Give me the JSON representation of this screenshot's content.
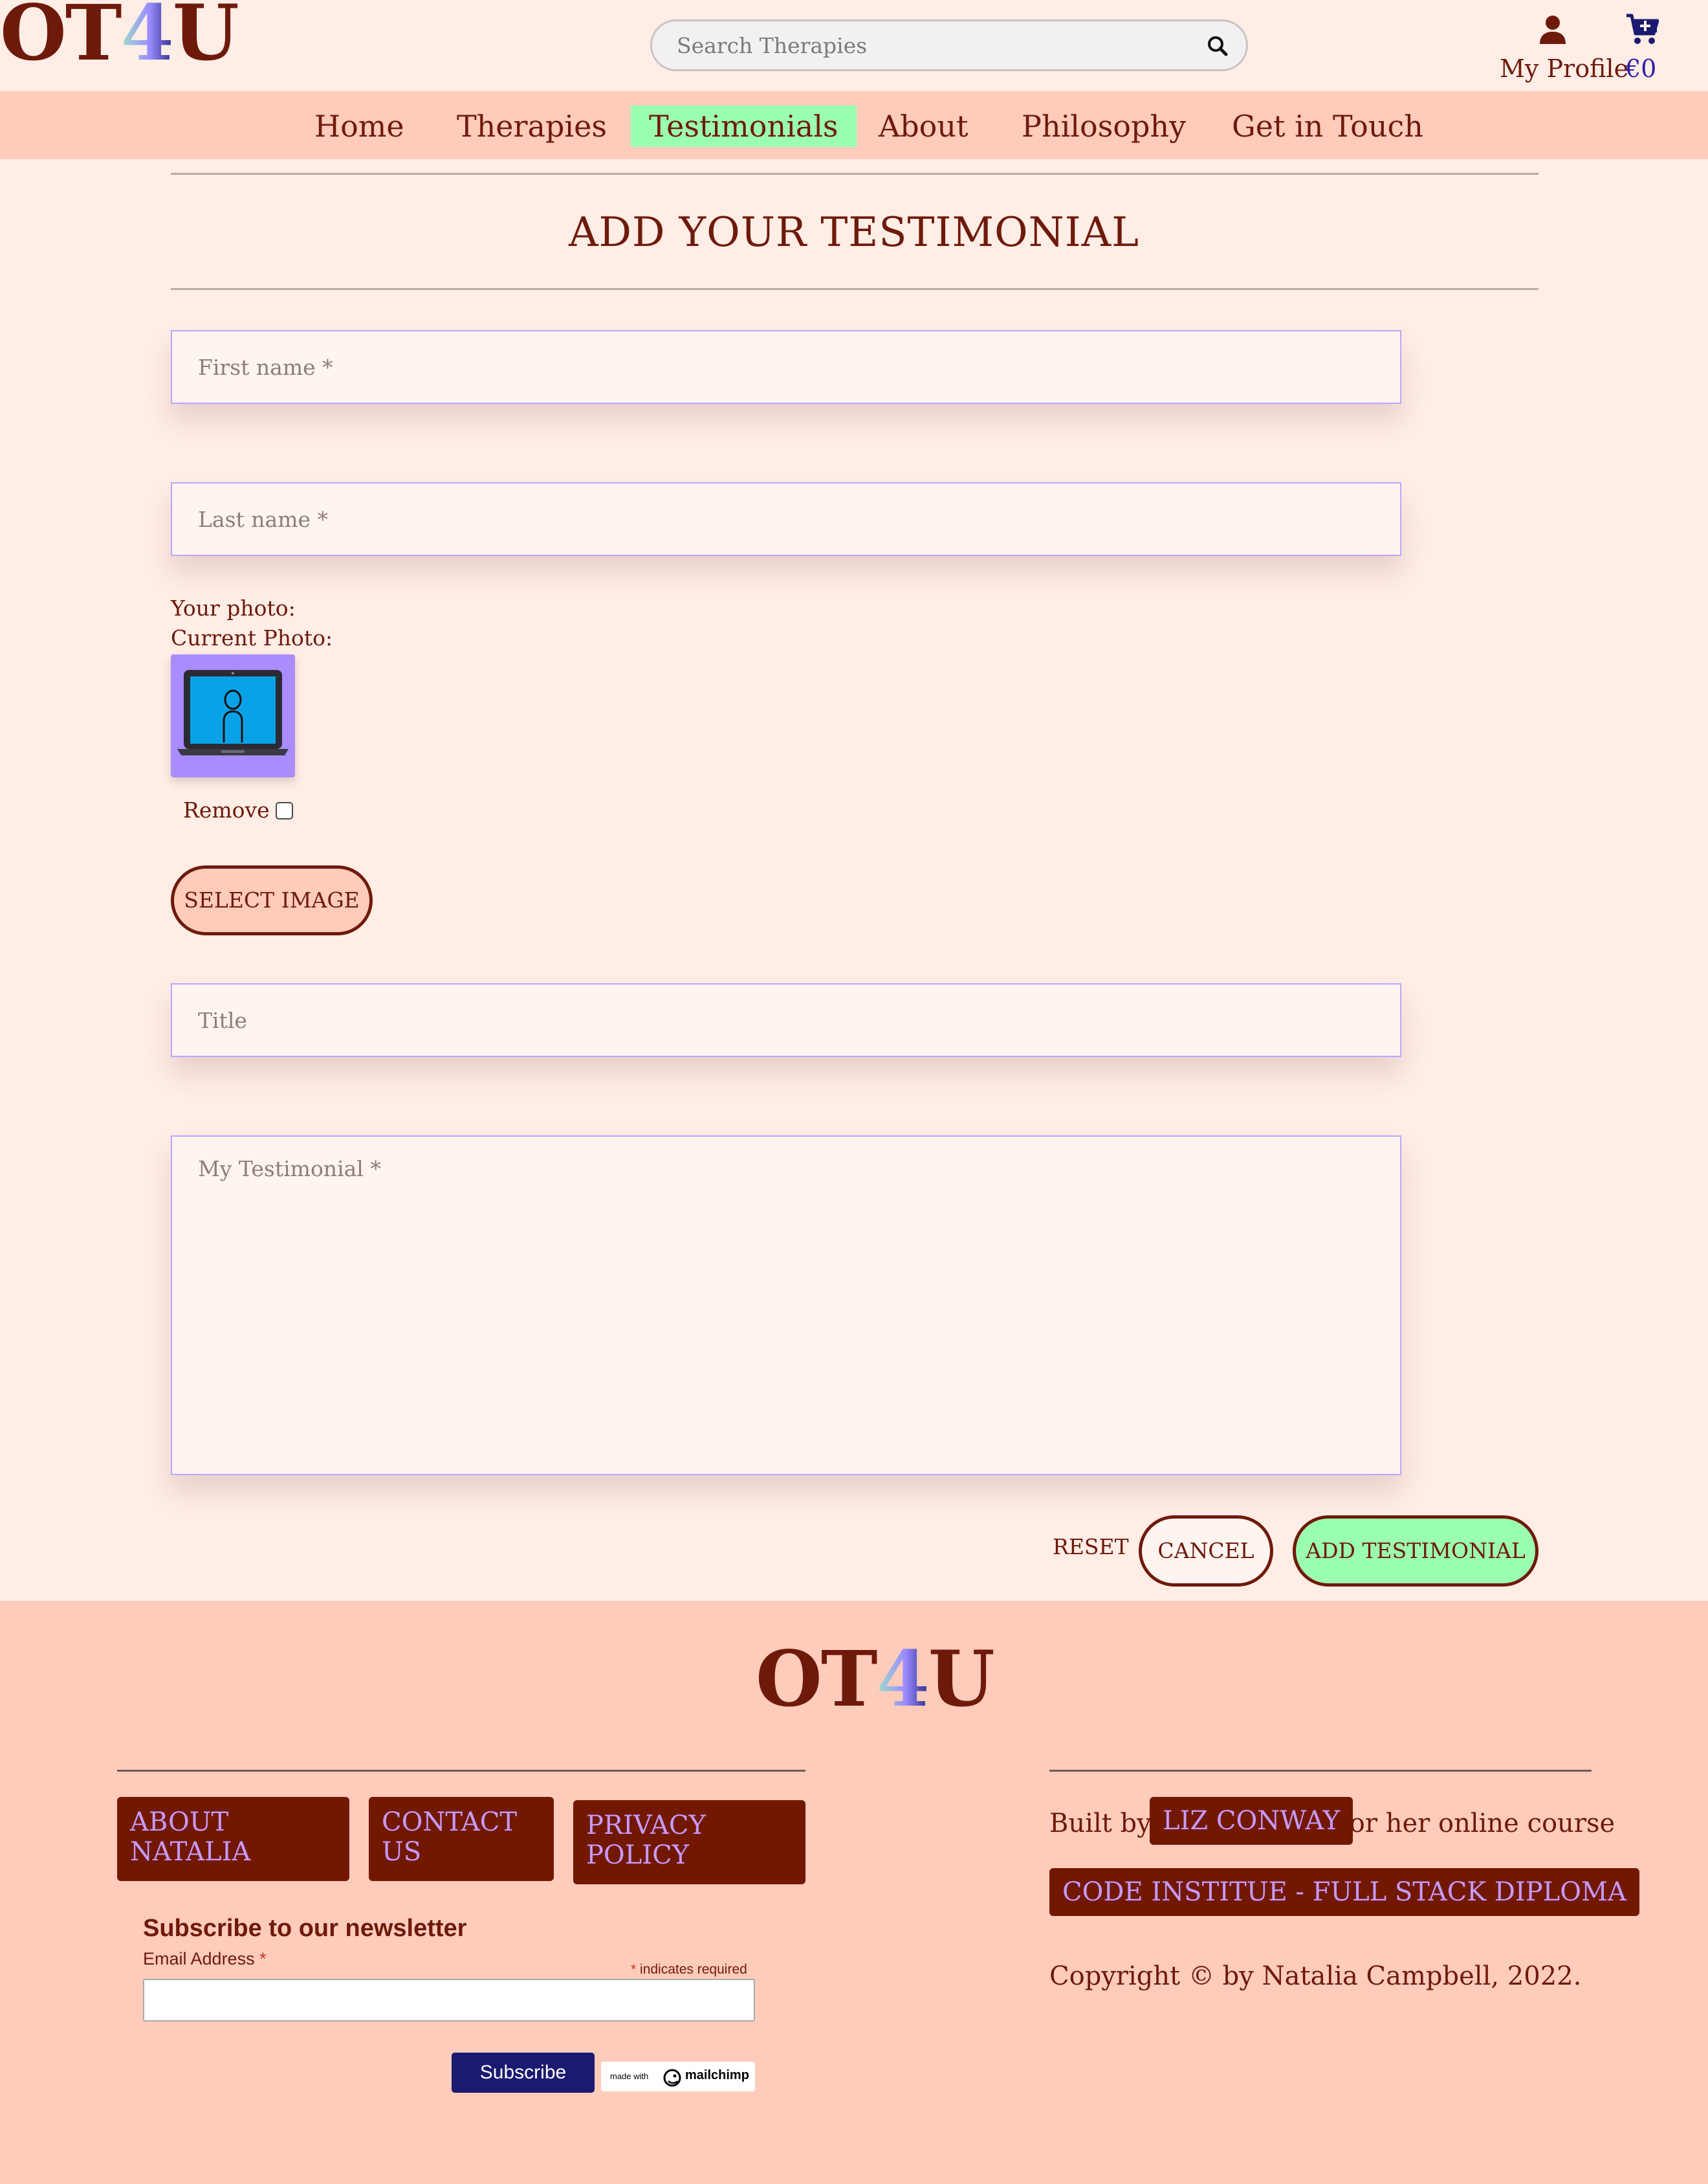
{
  "brand": {
    "logo_left": "OT",
    "logo_four": "4",
    "logo_right": "U"
  },
  "header": {
    "search_placeholder": "Search Therapies",
    "profile_label": "My Profile",
    "cart_total": "€0"
  },
  "nav": {
    "items": [
      {
        "label": "Home"
      },
      {
        "label": "Therapies"
      },
      {
        "label": "Testimonials"
      },
      {
        "label": "About"
      },
      {
        "label": "Philosophy"
      },
      {
        "label": "Get in Touch"
      }
    ]
  },
  "form": {
    "title": "ADD YOUR TESTIMONIAL",
    "first_name_placeholder": "First name *",
    "last_name_placeholder": "Last name *",
    "photo_label": "Your photo:",
    "current_photo_label": "Current Photo:",
    "remove_label": "Remove",
    "select_image_label": "SELECT IMAGE",
    "title_placeholder": "Title",
    "testimonial_placeholder": "My Testimonial *",
    "reset_label": "RESET",
    "cancel_label": "CANCEL",
    "submit_label": "ADD TESTIMONIAL"
  },
  "footer": {
    "links": [
      {
        "label": "ABOUT\nNATALIA"
      },
      {
        "label": "CONTACT\nUS"
      },
      {
        "label": "PRIVACY\nPOLICY"
      }
    ],
    "newsletter": {
      "title": "Subscribe to our newsletter",
      "email_label": "Email Address",
      "required_marker": "*",
      "required_note": "indicates required",
      "subscribe_label": "Subscribe",
      "badge_small": "made with",
      "badge_brand": "mailchimp"
    },
    "built_by_prefix": "Built by",
    "author_link": "LIZ CONWAY",
    "built_by_suffix": "for her online course",
    "course_link": "CODE INSTITUE - FULL STACK DIPLOMA",
    "course_suffix": ".",
    "copyright": "Copyright © by Natalia Campbell, 2022."
  },
  "colors": {
    "background": "#ffede6",
    "nav_background": "#ffcbbb",
    "primary_text": "#6e1a0b",
    "active_tab": "#9bffb0",
    "footer_button": "#731800",
    "footer_link_text": "#c69bff",
    "subscribe_button": "#1a1a70"
  },
  "icons": {
    "search": "search-icon",
    "profile": "user-icon",
    "cart": "cart-plus-icon",
    "photo": "laptop-user-icon"
  }
}
